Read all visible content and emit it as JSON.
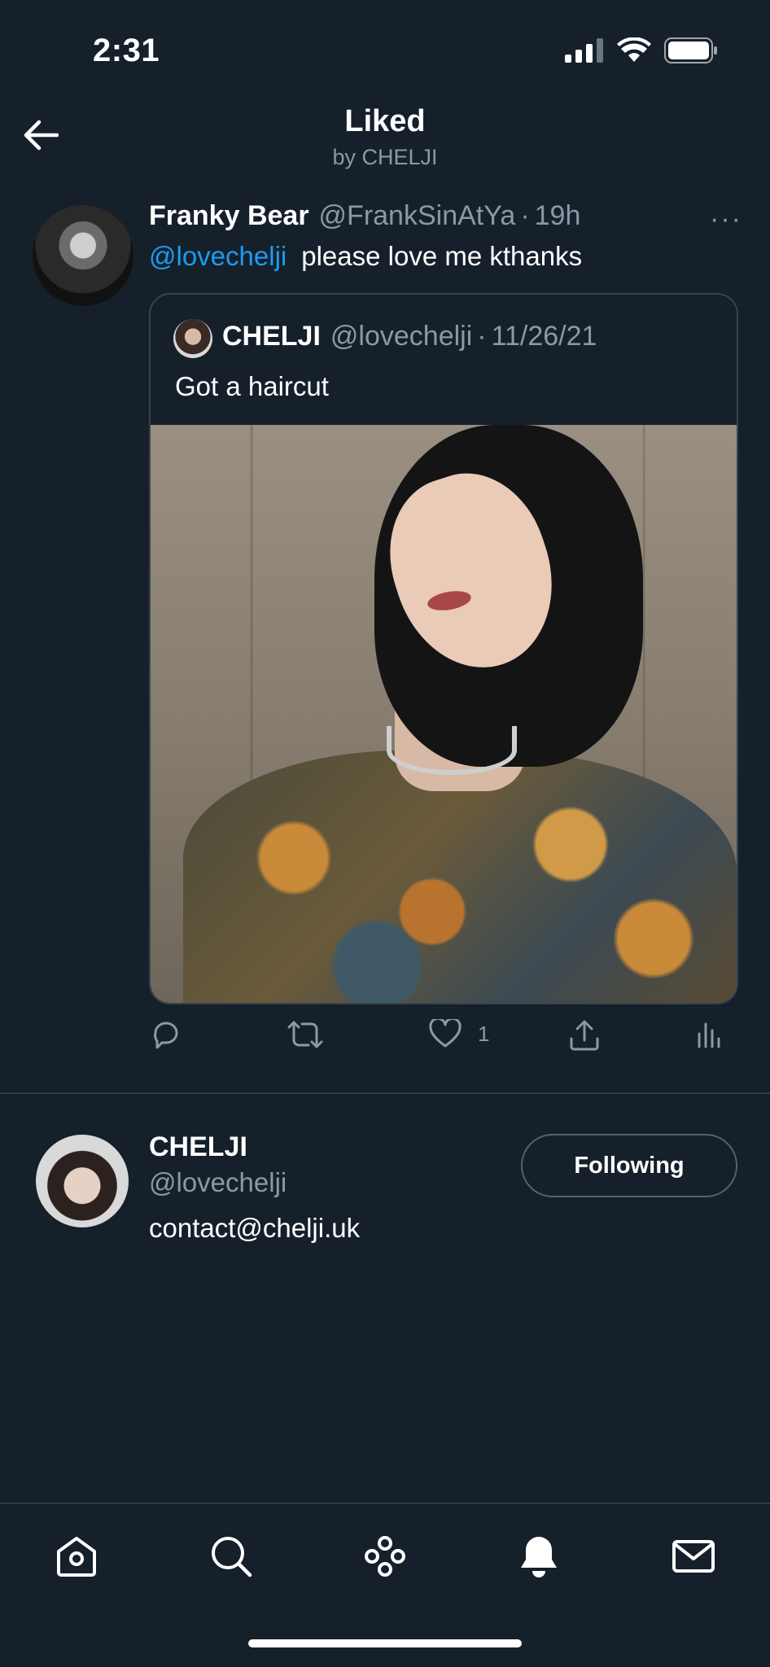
{
  "status": {
    "time": "2:31"
  },
  "header": {
    "title": "Liked",
    "subtitle": "by CHELJI"
  },
  "tweet": {
    "name": "Franky Bear",
    "handle": "@FrankSinAtYa",
    "separator": "·",
    "time": "19h",
    "more": "···",
    "mention": "@lovechelji",
    "text": "please love me kthanks",
    "quoted": {
      "name": "CHELJI",
      "handle": "@lovechelji",
      "separator": "·",
      "date": "11/26/21",
      "text": "Got a haircut"
    },
    "likes": "1"
  },
  "liker": {
    "name": "CHELJI",
    "handle": "@lovechelji",
    "bio": "contact@chelji.uk",
    "follow_label": "Following"
  },
  "colors": {
    "background": "#15202b",
    "accent": "#1d9bf0",
    "muted": "#8b98a5"
  }
}
